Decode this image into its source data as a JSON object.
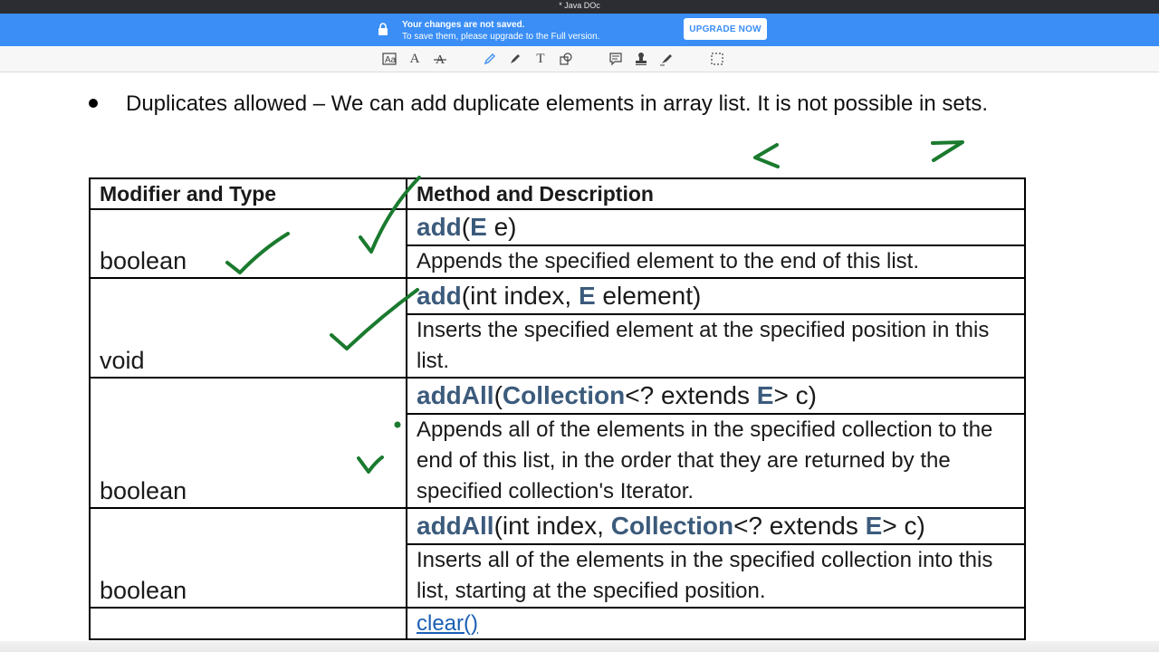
{
  "window": {
    "title": "* Java DOc"
  },
  "banner": {
    "line1": "Your changes are not saved.",
    "line2": "To save them, please upgrade to the Full version.",
    "button": "UPGRADE NOW"
  },
  "toolbar": {
    "tools": [
      "text-style-icon",
      "font-icon",
      "strikethrough-icon",
      "pen-icon",
      "eraser-icon",
      "text-tool-icon",
      "shapes-icon",
      "comment-icon",
      "stamp-icon",
      "signature-icon",
      "select-icon"
    ]
  },
  "document": {
    "bullet": "Duplicates allowed – We can add duplicate elements in array list. It is not possible in sets.",
    "table": {
      "headers": [
        "Modifier and Type",
        "Method and Description"
      ],
      "rows": [
        {
          "type": "boolean",
          "sig": [
            [
              "add",
              "kw"
            ],
            [
              "(",
              ""
            ],
            [
              "E",
              "kw"
            ],
            [
              " e)",
              ""
            ]
          ],
          "desc": "Appends the specified element to the end of this list."
        },
        {
          "type": "void",
          "sig": [
            [
              "add",
              "kw"
            ],
            [
              "(int index, ",
              ""
            ],
            [
              "E",
              "kw"
            ],
            [
              " element)",
              ""
            ]
          ],
          "desc": "Inserts the specified element at the specified position in this list."
        },
        {
          "type": "boolean",
          "sig": [
            [
              "addAll",
              "kw"
            ],
            [
              "(",
              ""
            ],
            [
              "Collection",
              "kw"
            ],
            [
              "<? extends ",
              ""
            ],
            [
              "E",
              "kw"
            ],
            [
              "> c)",
              ""
            ]
          ],
          "desc": "Appends all of the elements in the specified collection to the end of this list, in the order that they are returned by the specified collection's Iterator."
        },
        {
          "type": "boolean",
          "sig": [
            [
              "addAll",
              "kw"
            ],
            [
              "(int index, ",
              ""
            ],
            [
              "Collection",
              "kw"
            ],
            [
              "<? extends ",
              ""
            ],
            [
              "E",
              "kw"
            ],
            [
              "> c)",
              ""
            ]
          ],
          "desc": "Inserts all of the elements in the specified collection into this list, starting at the specified position."
        }
      ],
      "last_link": "clear()"
    },
    "ink_color": "#1a7a2e"
  }
}
